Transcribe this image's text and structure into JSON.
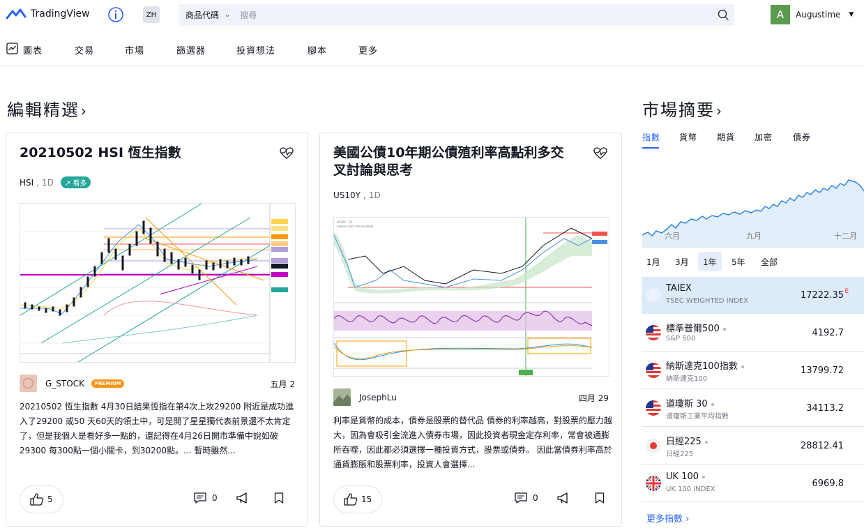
{
  "header": {
    "logo_text": "TradingView",
    "lang": "ZH",
    "search_type": "商品代碼",
    "search_placeholder": "搜尋",
    "user_initial": "A",
    "username": "Augustime"
  },
  "nav": {
    "items": [
      {
        "label": "圖表"
      },
      {
        "label": "交易"
      },
      {
        "label": "市場"
      },
      {
        "label": "篩選器"
      },
      {
        "label": "投資想法"
      },
      {
        "label": "腳本"
      },
      {
        "label": "更多"
      }
    ]
  },
  "editors_picks": {
    "title": "編輯精選",
    "cards": [
      {
        "title": "20210502 HSI 恆生指數",
        "symbol": "HSI",
        "timeframe": "1D",
        "badge": "看多",
        "author": "G_STOCK",
        "author_badge": "PREMIUM",
        "date": "五月 2",
        "body": "20210502 恆生指數 4月30日結果恆指在第4次上攻29200 附近是成功進入了29200 或50 天60天的領土中，可是開了星星獨代表前景還不太肯定了，但是我個人是看好多一點的，還記得在4月26日開市準備中說如破29300 每300點一個小關卡，到30200點。... 暫時雖然...",
        "likes": "5",
        "comments": "0"
      },
      {
        "title": "美國公債10年期公債殖利率高點利多交叉討論與思考",
        "symbol": "US10Y",
        "timeframe": "1D",
        "author": "JosephLu",
        "date": "四月 29",
        "body": "利率是貨幣的成本，債券是股票的替代品 債券的利率越高，對股票的壓力越大，因為會吸引金流進入債券市場，因此投資者現金定存利率，常會被通膨所吞噬，因此都必須選擇一種投資方式，股票或債券。 因此當債券利率高於通貨膨脹和股票利率，投資人會選擇...",
        "likes": "15",
        "comments": "0"
      }
    ]
  },
  "market_summary": {
    "title": "市場摘要",
    "tabs": [
      {
        "label": "指數"
      },
      {
        "label": "貨幣"
      },
      {
        "label": "期貨"
      },
      {
        "label": "加密"
      },
      {
        "label": "債券"
      }
    ],
    "chart_months": [
      "六月",
      "九月",
      "十二月"
    ],
    "ranges": [
      {
        "label": "1月"
      },
      {
        "label": "3月"
      },
      {
        "label": "1年"
      },
      {
        "label": "5年"
      },
      {
        "label": "全部"
      }
    ],
    "indices": [
      {
        "name": "TAIEX",
        "desc": "TSEC WEIGHTED INDEX",
        "value": "17222.35",
        "flag": "T",
        "suffix": "E"
      },
      {
        "name": "標準普爾500",
        "desc": "S&P 500",
        "value": "4192.7",
        "flag": "us"
      },
      {
        "name": "納斯達克100指數",
        "desc": "納斯達克100",
        "value": "13799.72",
        "flag": "us"
      },
      {
        "name": "道瓊斯 30",
        "desc": "道瓊斯工業平均指數",
        "value": "34113.2",
        "flag": "us"
      },
      {
        "name": "日經225",
        "desc": "日經225",
        "value": "28812.41",
        "flag": "jp"
      },
      {
        "name": "UK 100",
        "desc": "UK 100 INDEX",
        "value": "6969.8",
        "flag": "uk"
      }
    ],
    "more_label": "更多指數 ›"
  },
  "colors": {
    "accent": "#2962ff",
    "long_badge": "#26a69a",
    "premium": "#f7931a"
  }
}
